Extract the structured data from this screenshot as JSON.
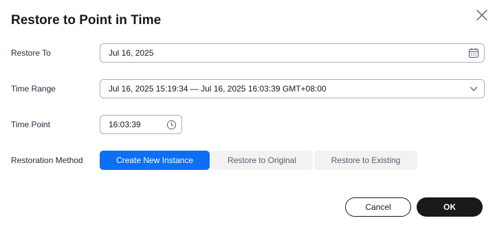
{
  "dialog": {
    "title": "Restore to Point in Time"
  },
  "form": {
    "restore_to": {
      "label": "Restore To",
      "value": "Jul 16, 2025"
    },
    "time_range": {
      "label": "Time Range",
      "value": "Jul 16, 2025 15:19:34 — Jul 16, 2025 16:03:39 GMT+08:00"
    },
    "time_point": {
      "label": "Time Point",
      "value": "16:03:39"
    },
    "restoration_method": {
      "label": "Restoration Method",
      "options": [
        {
          "label": "Create New Instance",
          "selected": true
        },
        {
          "label": "Restore to Original",
          "selected": false
        },
        {
          "label": "Restore to Existing",
          "selected": false
        }
      ]
    }
  },
  "footer": {
    "cancel_label": "Cancel",
    "ok_label": "OK"
  },
  "colors": {
    "accent": "#0d6ff5",
    "primary_button": "#191919",
    "border": "#adb0b8",
    "inactive_option_bg": "#f2f2f2"
  },
  "icons": {
    "close": "close-icon",
    "calendar": "calendar-icon",
    "dropdown": "chevron-down-icon",
    "clock": "clock-icon"
  }
}
